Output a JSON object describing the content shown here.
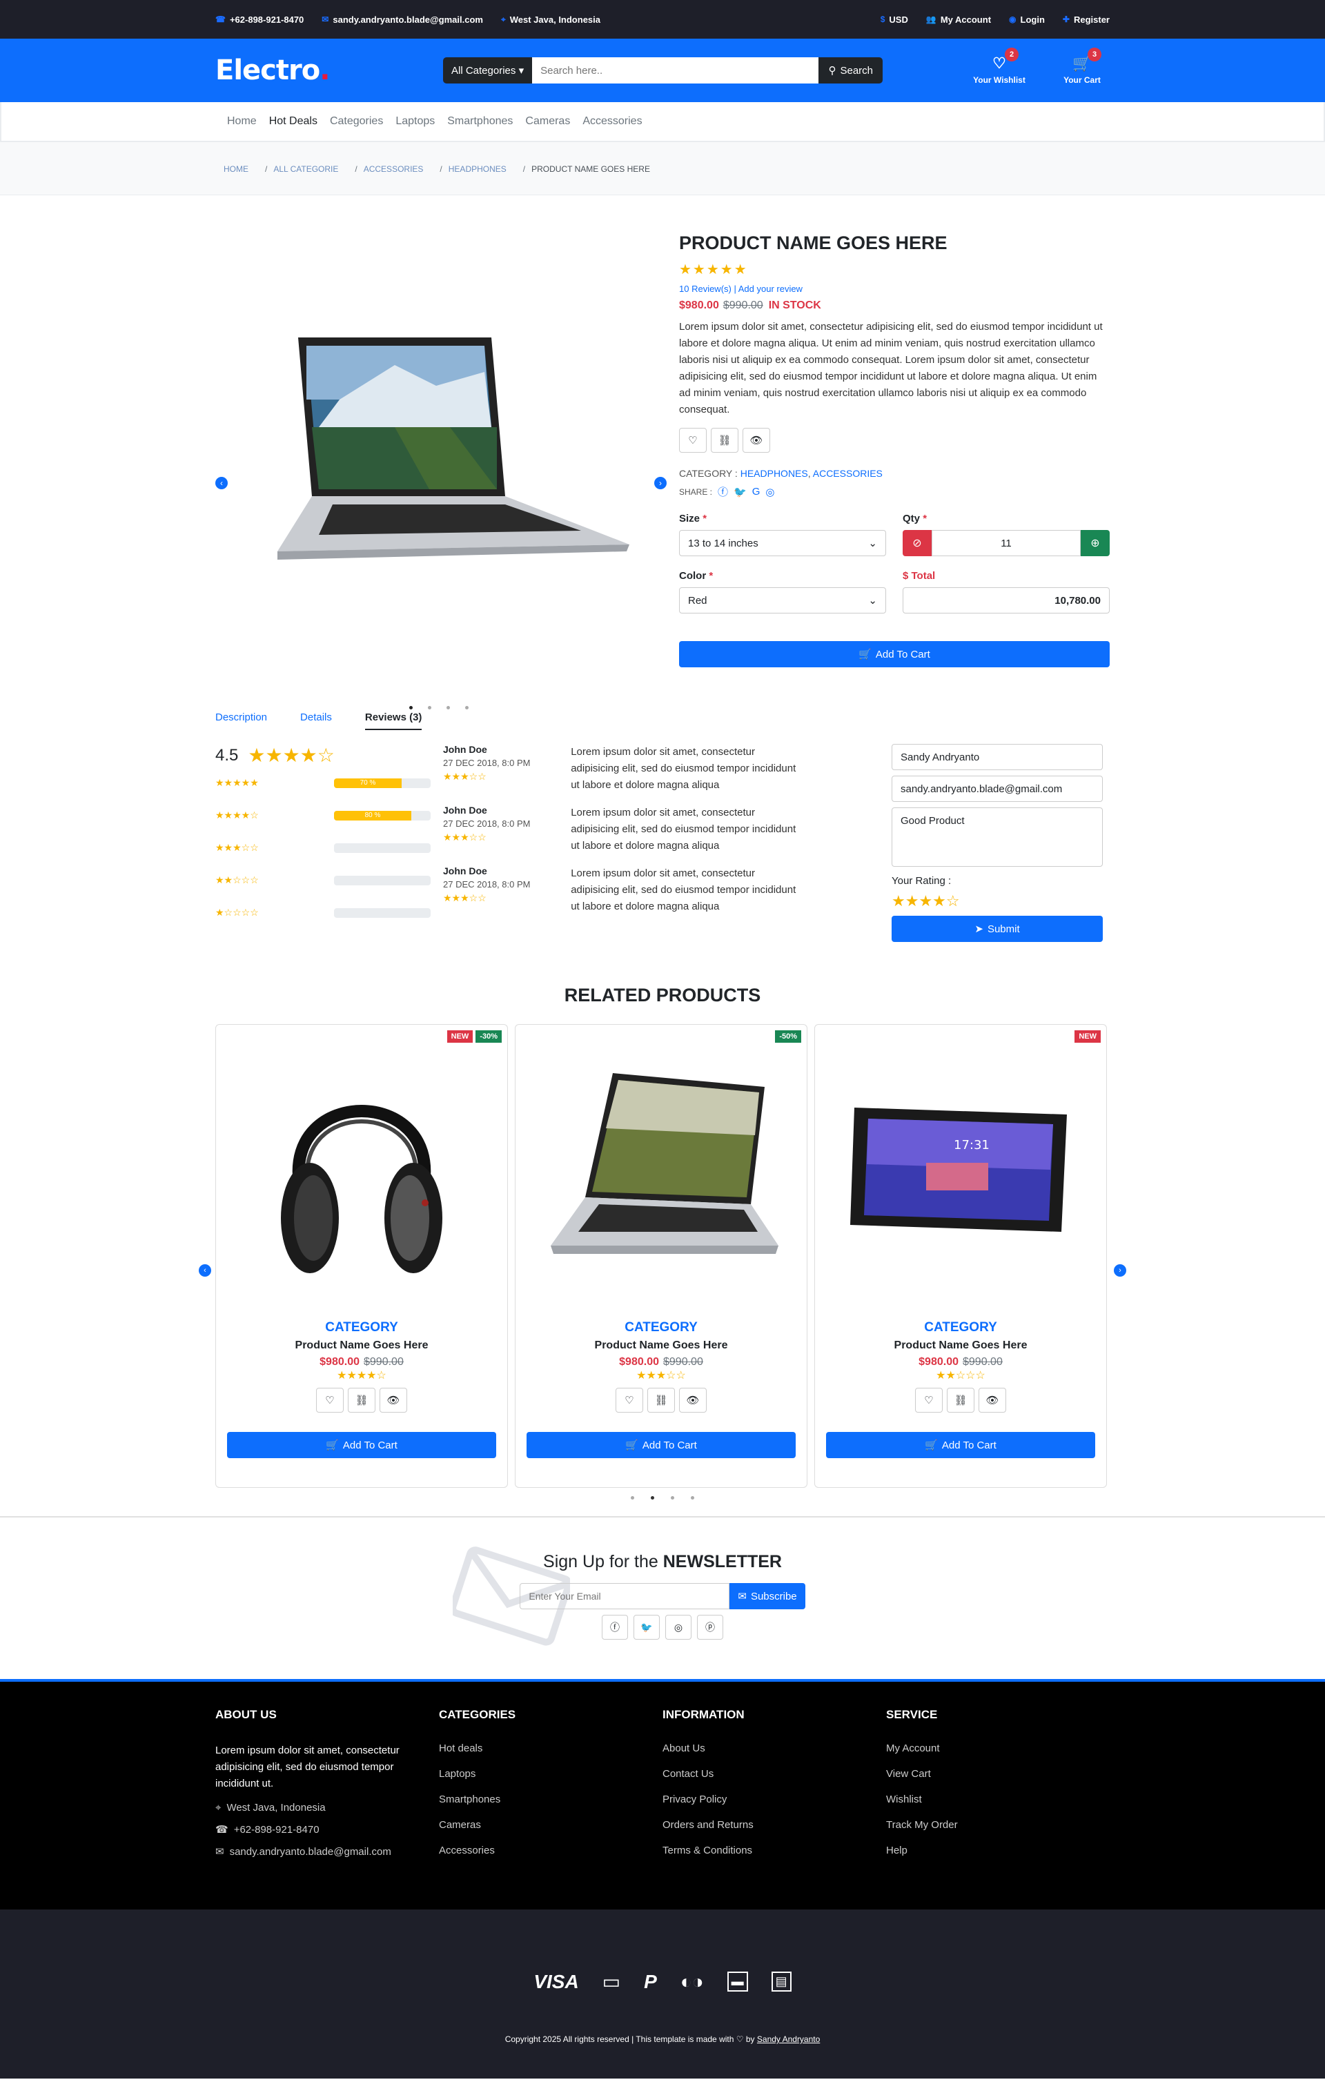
{
  "topbar": {
    "phone": "+62-898-921-8470",
    "email": "sandy.andryanto.blade@gmail.com",
    "location": "West Java, Indonesia",
    "currency": "USD",
    "account": "My Account",
    "login": "Login",
    "register": "Register"
  },
  "header": {
    "logo": "Electro",
    "logo_dot": ".",
    "category_select": "All Categories",
    "search_placeholder": "Search here..",
    "search_button": "Search",
    "wishlist_label": "Your Wishlist",
    "wishlist_count": "2",
    "cart_label": "Your Cart",
    "cart_count": "3"
  },
  "nav": {
    "items": [
      "Home",
      "Hot Deals",
      "Categories",
      "Laptops",
      "Smartphones",
      "Cameras",
      "Accessories"
    ]
  },
  "breadcrumb": [
    "HOME",
    "ALL CATEGORIE",
    "ACCESSORIES",
    "HEADPHONES",
    "PRODUCT NAME GOES HERE"
  ],
  "product": {
    "name": "PRODUCT NAME GOES HERE",
    "rating_stars": "★★★★★",
    "review_link": "10 Review(s) | Add your review",
    "price": "$980.00",
    "old_price": "$990.00",
    "stock": "IN STOCK",
    "description": "Lorem ipsum dolor sit amet, consectetur adipisicing elit, sed do eiusmod tempor incididunt ut labore et dolore magna aliqua. Ut enim ad minim veniam, quis nostrud exercitation ullamco laboris nisi ut aliquip ex ea commodo consequat. Lorem ipsum dolor sit amet, consectetur adipisicing elit, sed do eiusmod tempor incididunt ut labore et dolore magna aliqua. Ut enim ad minim veniam, quis nostrud exercitation ullamco laboris nisi ut aliquip ex ea commodo consequat.",
    "category_label": "CATEGORY :",
    "category_links": [
      "HEADPHONES",
      "ACCESSORIES"
    ],
    "share_label": "SHARE :",
    "size_label": "Size",
    "size_value": "13 to 14 inches",
    "qty_label": "Qty",
    "qty_value": "11",
    "color_label": "Color",
    "color_value": "Red",
    "total_label": "$ Total",
    "total_value": "10,780.00",
    "add_to_cart": "Add To Cart"
  },
  "tabs": [
    "Description",
    "Details",
    "Reviews (3)"
  ],
  "reviews": {
    "average": "4.5",
    "breakdown": [
      {
        "stars": "★★★★★",
        "percent": 70,
        "label": "70 %"
      },
      {
        "stars": "★★★★☆",
        "percent": 80,
        "label": "80 %"
      },
      {
        "stars": "★★★☆☆",
        "percent": 0,
        "label": ""
      },
      {
        "stars": "★★☆☆☆",
        "percent": 0,
        "label": ""
      },
      {
        "stars": "★☆☆☆☆",
        "percent": 0,
        "label": ""
      }
    ],
    "items": [
      {
        "name": "John Doe",
        "date": "27 DEC 2018, 8:0 PM",
        "stars": "★★★☆☆",
        "text": "Lorem ipsum dolor sit amet, consectetur adipisicing elit, sed do eiusmod tempor incididunt ut labore et dolore magna aliqua"
      },
      {
        "name": "John Doe",
        "date": "27 DEC 2018, 8:0 PM",
        "stars": "★★★☆☆",
        "text": "Lorem ipsum dolor sit amet, consectetur adipisicing elit, sed do eiusmod tempor incididunt ut labore et dolore magna aliqua"
      },
      {
        "name": "John Doe",
        "date": "27 DEC 2018, 8:0 PM",
        "stars": "★★★☆☆",
        "text": "Lorem ipsum dolor sit amet, consectetur adipisicing elit, sed do eiusmod tempor incididunt ut labore et dolore magna aliqua"
      }
    ],
    "form": {
      "name": "Sandy Andryanto",
      "email": "sandy.andryanto.blade@gmail.com",
      "review": "Good Product",
      "rating_label": "Your Rating :",
      "rating_stars": "★★★★☆",
      "submit": "Submit"
    }
  },
  "related": {
    "title": "RELATED PRODUCTS",
    "products": [
      {
        "badges": [
          {
            "text": "NEW",
            "type": "new"
          },
          {
            "text": "-30%",
            "type": "off"
          }
        ],
        "image": "headphones",
        "category": "CATEGORY",
        "name": "Product Name Goes Here",
        "price": "$980.00",
        "old_price": "$990.00",
        "stars": "★★★★☆",
        "cta": "Add To Cart"
      },
      {
        "badges": [
          {
            "text": "-50%",
            "type": "off"
          }
        ],
        "image": "laptop",
        "category": "CATEGORY",
        "name": "Product Name Goes Here",
        "price": "$980.00",
        "old_price": "$990.00",
        "stars": "★★★☆☆",
        "cta": "Add To Cart"
      },
      {
        "badges": [
          {
            "text": "NEW",
            "type": "new"
          }
        ],
        "image": "tablet",
        "category": "CATEGORY",
        "name": "Product Name Goes Here",
        "price": "$980.00",
        "old_price": "$990.00",
        "stars": "★★☆☆☆",
        "cta": "Add To Cart"
      }
    ]
  },
  "newsletter": {
    "title_prefix": "Sign Up for the",
    "title_bold": "NEWSLETTER",
    "placeholder": "Enter Your Email",
    "button": "Subscribe"
  },
  "footer": {
    "about_title": "ABOUT US",
    "about_text": "Lorem ipsum dolor sit amet, consectetur adipisicing elit, sed do eiusmod tempor incididunt ut.",
    "address": "West Java, Indonesia",
    "phone": "+62-898-921-8470",
    "email": "sandy.andryanto.blade@gmail.com",
    "categories_title": "CATEGORIES",
    "categories": [
      "Hot deals",
      "Laptops",
      "Smartphones",
      "Cameras",
      "Accessories"
    ],
    "information_title": "INFORMATION",
    "information": [
      "About Us",
      "Contact Us",
      "Privacy Policy",
      "Orders and Returns",
      "Terms & Conditions"
    ],
    "service_title": "SERVICE",
    "service": [
      "My Account",
      "View Cart",
      "Wishlist",
      "Track My Order",
      "Help"
    ],
    "payments": [
      "VISA",
      "credit-card",
      "paypal",
      "mastercard",
      "discover",
      "american-express"
    ],
    "copyright": "Copyright 2025 All rights reserved | This template is made with",
    "by": "by",
    "author": "Sandy Andryanto"
  }
}
